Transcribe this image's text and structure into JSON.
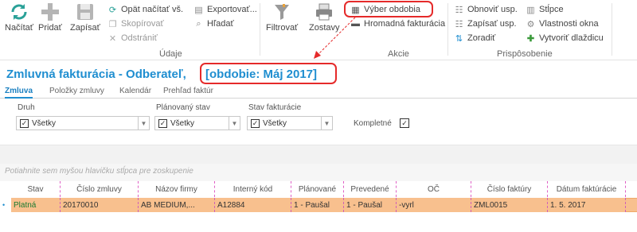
{
  "ribbon": {
    "reload_label": "Načítať",
    "add_label": "Pridať",
    "save_label": "Zapísať",
    "reload_all_label": "Opät načítať vš.",
    "copy_label": "Skopírovať",
    "delete_label": "Odstrániť",
    "export_label": "Exportovať...",
    "search_label": "Hľadať",
    "group_data_label": "Údaje",
    "filter_label": "Filtrovať",
    "reports_label": "Zostavy",
    "period_select_label": "Výber obdobia",
    "bulk_invoicing_label": "Hromadná fakturácia",
    "group_actions_label": "Akcie",
    "refresh_settings_label": "Obnoviť usp.",
    "save_settings_label": "Zapísať usp.",
    "sort_label": "Zoradiť",
    "columns_label": "Stĺpce",
    "window_props_label": "Vlastnosti okna",
    "create_tile_label": "Vytvoriť dlaždicu",
    "group_customize_label": "Prispôsobenie"
  },
  "title": {
    "main": "Zmluvná fakturácia - Odberateľ,",
    "period": "[obdobie: Máj 2017]"
  },
  "tabs": [
    {
      "label": "Zmluva"
    },
    {
      "label": "Položky zmluvy"
    },
    {
      "label": "Kalendár"
    },
    {
      "label": "Prehľad faktúr"
    }
  ],
  "filters": {
    "type_label": "Druh",
    "type_value": "Všetky",
    "planned_label": "Plánovaný stav",
    "planned_value": "Všetky",
    "invoicing_label": "Stav fakturácie",
    "invoicing_value": "Všetky",
    "complete_label": "Kompletné"
  },
  "grid": {
    "group_hint": "Potiahnite sem myšou hlavičku stĺpca pre zoskupenie",
    "columns": [
      "Stav",
      "Číslo zmluvy",
      "Názov firmy",
      "Interný kód",
      "Plánované",
      "Prevedené",
      "OČ",
      "Číslo faktúry",
      "Dátum faktúrácie"
    ],
    "rows": [
      [
        "Platná",
        "20170010",
        "AB MEDIUM,...",
        "A12884",
        "1 - Paušal",
        "1 - Paušal",
        "-vyrl",
        "ZML0015",
        "1. 5. 2017"
      ]
    ]
  },
  "colors": {
    "accent": "#1f8ed0",
    "highlight_row": "#f8c08e",
    "annotation_red": "#e52a2a"
  }
}
